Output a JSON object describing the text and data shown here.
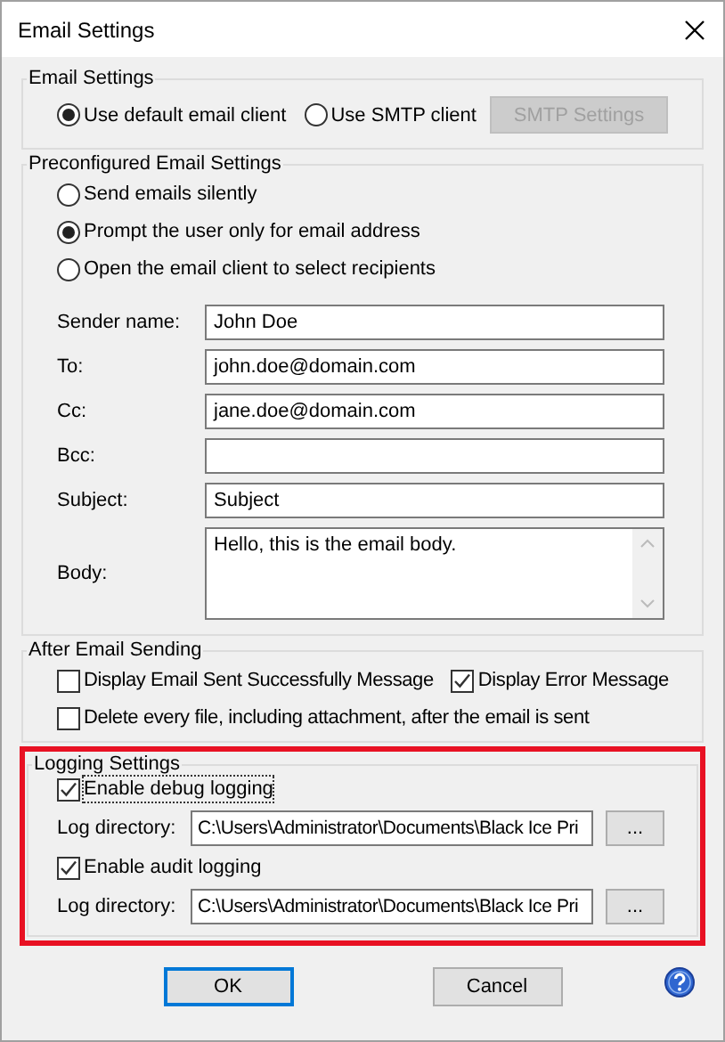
{
  "window": {
    "title": "Email Settings"
  },
  "email_settings": {
    "title": "Email Settings",
    "options": [
      {
        "label": "Use default email client",
        "selected": true
      },
      {
        "label": "Use SMTP client",
        "selected": false
      }
    ],
    "smtp_button": {
      "label": "SMTP Settings",
      "disabled": true
    }
  },
  "preconfigured": {
    "title": "Preconfigured Email Settings",
    "options": [
      {
        "label": "Send emails silently",
        "selected": false
      },
      {
        "label": "Prompt the user only for email address",
        "selected": true
      },
      {
        "label": "Open the email client to select recipients",
        "selected": false
      }
    ],
    "fields": [
      {
        "kind": "line",
        "label": "Sender name:",
        "value": "John Doe"
      },
      {
        "kind": "line",
        "label": "To:",
        "value": "john.doe@domain.com"
      },
      {
        "kind": "line",
        "label": "Cc:",
        "value": "jane.doe@domain.com"
      },
      {
        "kind": "line",
        "label": "Bcc:"
      },
      {
        "kind": "line",
        "label": "Subject:",
        "value": "Subject"
      },
      {
        "kind": "multiline",
        "label": "Body:",
        "value": "Hello, this is the email body."
      }
    ]
  },
  "after_sending": {
    "title": "After Email Sending",
    "options": [
      {
        "label": "Display Email Sent Successfully Message",
        "checked": false
      },
      {
        "label": "Display Error Message",
        "checked": true
      },
      {
        "label": "Delete every file, including attachment, after the email is sent",
        "checked": false
      }
    ]
  },
  "logging": {
    "title": "Logging Settings",
    "sections": [
      {
        "label": "Enable debug logging",
        "checked": true,
        "focused": true,
        "directory_label": "Log directory:",
        "directory": "C:\\Users\\Administrator\\Documents\\Black Ice Pri",
        "browse_label": "..."
      },
      {
        "label": "Enable audit logging",
        "checked": true,
        "focused": false,
        "directory_label": "Log directory:",
        "directory": "C:\\Users\\Administrator\\Documents\\Black Ice Pri",
        "browse_label": "..."
      }
    ]
  },
  "buttons": [
    {
      "label": "OK",
      "default": true
    },
    {
      "label": "Cancel",
      "default": false
    }
  ]
}
